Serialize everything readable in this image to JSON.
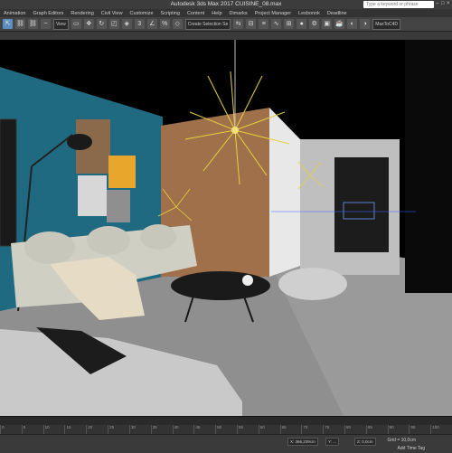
{
  "window": {
    "title": "Autodesk 3ds Max 2017    CUISINE_08.max",
    "search_placeholder": "Type a keyword or phrase"
  },
  "menu": [
    "Animation",
    "Graph Editors",
    "Rendering",
    "Civil View",
    "Customize",
    "Scripting",
    "Content",
    "Help",
    "Dimarks",
    "Project Manager",
    "Lesbonnk",
    "Deadline"
  ],
  "toolbar": {
    "view_select": "View",
    "selection_set": "Create Selection Se",
    "snap_label": "3",
    "right_label": "MaxToC4D"
  },
  "status": {
    "x_field": "X: 366,239cm",
    "y_field": "Y: ...",
    "z_field": "Z: 0,0cm",
    "grid": "Grid = 10,0cm",
    "add_time_tag": "Add Time Tag"
  },
  "ruler_ticks": [
    "0",
    "5",
    "10",
    "15",
    "20",
    "25",
    "30",
    "35",
    "40",
    "45",
    "50",
    "55",
    "60",
    "65",
    "70",
    "75",
    "80",
    "85",
    "90",
    "95",
    "100"
  ]
}
